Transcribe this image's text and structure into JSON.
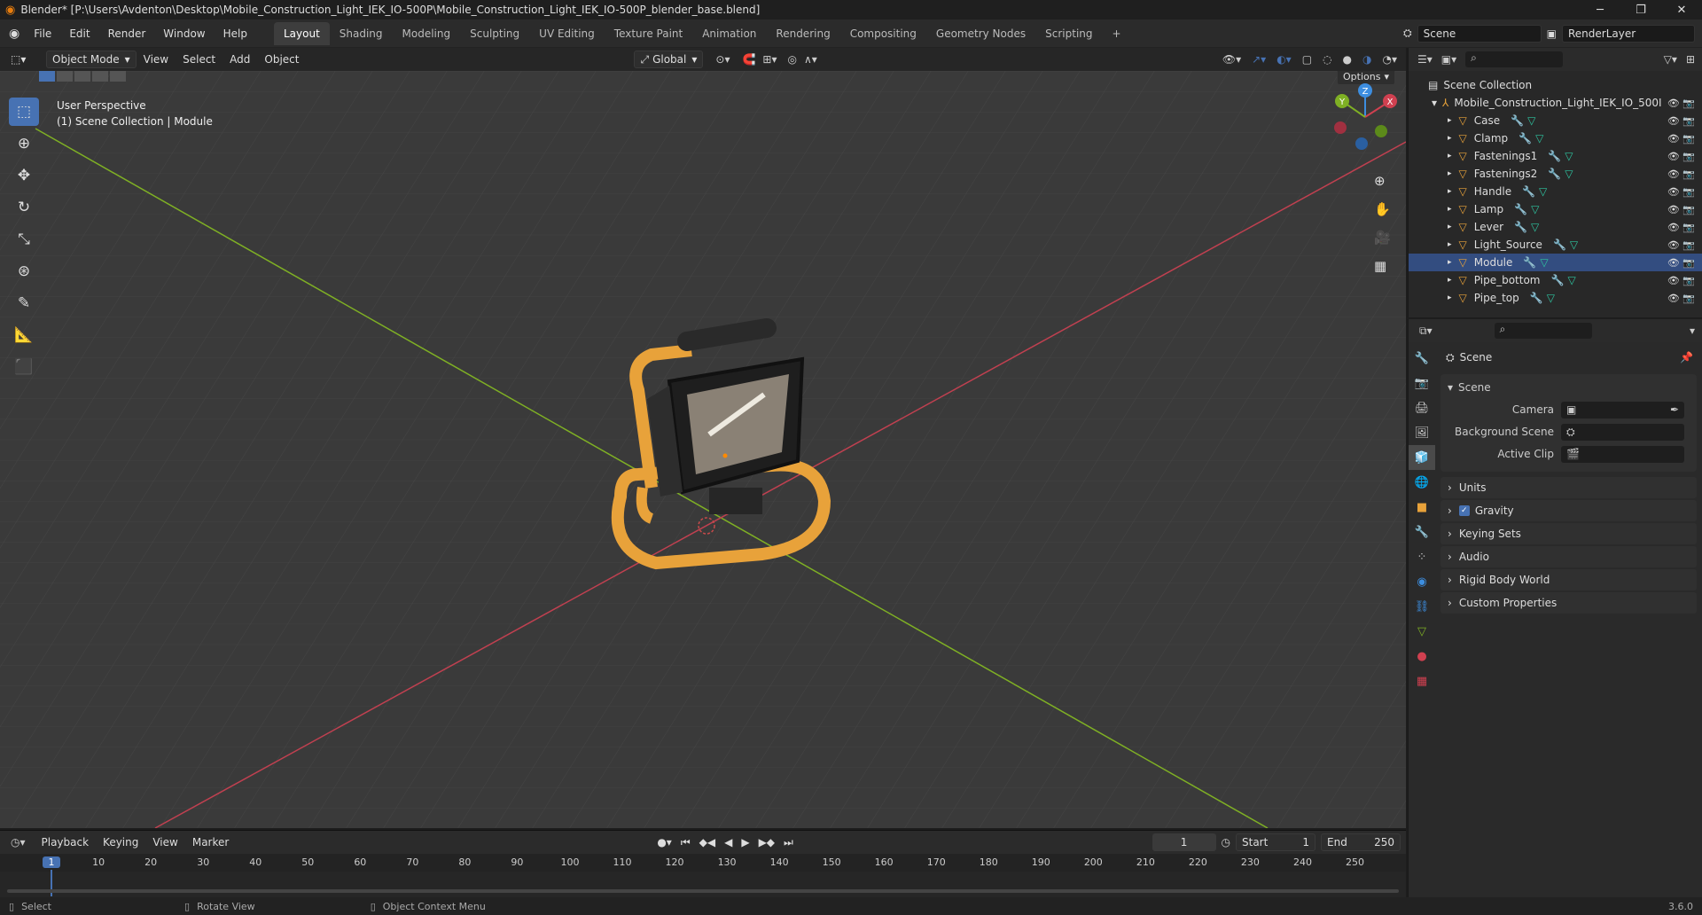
{
  "window": {
    "title": "Blender* [P:\\Users\\Avdenton\\Desktop\\Mobile_Construction_Light_IEK_IO-500P\\Mobile_Construction_Light_IEK_IO-500P_blender_base.blend]",
    "minimize": "─",
    "maximize": "❐",
    "close": "✕"
  },
  "menu": [
    "File",
    "Edit",
    "Render",
    "Window",
    "Help"
  ],
  "workspaces": [
    "Layout",
    "Shading",
    "Modeling",
    "Sculpting",
    "UV Editing",
    "Texture Paint",
    "Animation",
    "Rendering",
    "Compositing",
    "Geometry Nodes",
    "Scripting",
    "+"
  ],
  "scene_name": "Scene",
  "view_layer": "RenderLayer",
  "viewport_header": {
    "mode": "Object Mode",
    "menus": [
      "View",
      "Select",
      "Add",
      "Object"
    ],
    "orientation": "Global",
    "options": "Options"
  },
  "viewport": {
    "info_line1": "User Perspective",
    "info_line2": "(1) Scene Collection | Module",
    "gizmo_x": "X",
    "gizmo_y": "Y",
    "gizmo_z": "Z"
  },
  "outliner": {
    "root": "Scene Collection",
    "collection": "Mobile_Construction_Light_IEK_IO_500I",
    "items": [
      "Case",
      "Clamp",
      "Fastenings1",
      "Fastenings2",
      "Handle",
      "Lamp",
      "Lever",
      "Light_Source",
      "Module",
      "Pipe_bottom",
      "Pipe_top"
    ],
    "selected": "Module"
  },
  "properties": {
    "header": "Scene",
    "panel": "Scene",
    "fields": [
      {
        "label": "Camera",
        "value": ""
      },
      {
        "label": "Background Scene",
        "value": ""
      },
      {
        "label": "Active Clip",
        "value": ""
      }
    ],
    "sections": [
      "Units",
      "Gravity",
      "Keying Sets",
      "Audio",
      "Rigid Body World",
      "Custom Properties"
    ],
    "gravity_checked": true
  },
  "timeline": {
    "menus": [
      "Playback",
      "Keying",
      "View",
      "Marker"
    ],
    "current_frame": "1",
    "start_label": "Start",
    "start": "1",
    "end_label": "End",
    "end": "250",
    "ruler": [
      "1",
      "10",
      "20",
      "30",
      "40",
      "50",
      "60",
      "70",
      "80",
      "90",
      "100",
      "110",
      "120",
      "130",
      "140",
      "150",
      "160",
      "170",
      "180",
      "190",
      "200",
      "210",
      "220",
      "230",
      "240",
      "250"
    ]
  },
  "statusbar": {
    "select": "Select",
    "rotate": "Rotate View",
    "context": "Object Context Menu",
    "version": "3.6.0"
  },
  "colors": {
    "accent": "#4772b3",
    "x_axis": "#d04050",
    "y_axis": "#7fb024",
    "z_axis": "#3d8ee0",
    "object_orange": "#e8a23a"
  }
}
